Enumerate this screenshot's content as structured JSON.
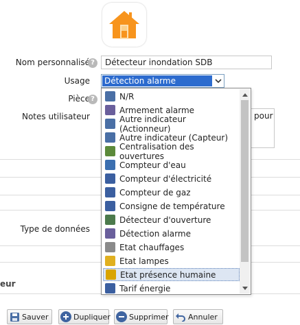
{
  "form": {
    "custom_name_label": "Nom personnalisé",
    "custom_name_value": "Détecteur inondation SDB",
    "usage_label": "Usage",
    "usage_value": "Détection alarme",
    "room_label": "Pièce",
    "user_notes_label": "Notes utilisateur",
    "notes_partial": "pour",
    "data_type_label": "Type de données",
    "partial_label": "eur"
  },
  "dropdown": {
    "selected_index": 13,
    "items": [
      {
        "label": "N/R",
        "icon": "generic-device-icon",
        "color": "#4a6fa5"
      },
      {
        "label": "Armement alarme",
        "icon": "alarm-arm-icon",
        "color": "#6a5f9c"
      },
      {
        "label": "Autre indicateur (Actionneur)",
        "icon": "actuator-icon",
        "color": "#4a6fa5"
      },
      {
        "label": "Autre indicateur (Capteur)",
        "icon": "sensor-icon",
        "color": "#4a6fa5"
      },
      {
        "label": "Centralisation des ouvertures",
        "icon": "openings-icon",
        "color": "#5c8a3a"
      },
      {
        "label": "Compteur d'eau",
        "icon": "water-meter-icon",
        "color": "#3b6fb0"
      },
      {
        "label": "Compteur d'électricité",
        "icon": "electricity-meter-icon",
        "color": "#3b5fa0"
      },
      {
        "label": "Compteur de gaz",
        "icon": "gas-meter-icon",
        "color": "#3b5fa0"
      },
      {
        "label": "Consigne de température",
        "icon": "thermostat-icon",
        "color": "#3b5fa0"
      },
      {
        "label": "Détecteur d'ouverture",
        "icon": "door-sensor-icon",
        "color": "#4c7a4c"
      },
      {
        "label": "Détection alarme",
        "icon": "alarm-detection-icon",
        "color": "#6a5f9c"
      },
      {
        "label": "Etat chauffages",
        "icon": "heater-icon",
        "color": "#8a8a8a"
      },
      {
        "label": "Etat lampes",
        "icon": "lamp-icon",
        "color": "#e0b020"
      },
      {
        "label": "Etat présence humaine",
        "icon": "presence-icon",
        "color": "#d9a400"
      },
      {
        "label": "Tarif énergie",
        "icon": "energy-tariff-icon",
        "color": "#3b5fa0"
      }
    ]
  },
  "buttons": {
    "save": "Sauver",
    "duplicate": "Dupliquer",
    "delete": "Supprimer",
    "cancel": "Annuler"
  },
  "colors": {
    "home_icon": "#f7941d",
    "selection": "#2c6bce"
  }
}
